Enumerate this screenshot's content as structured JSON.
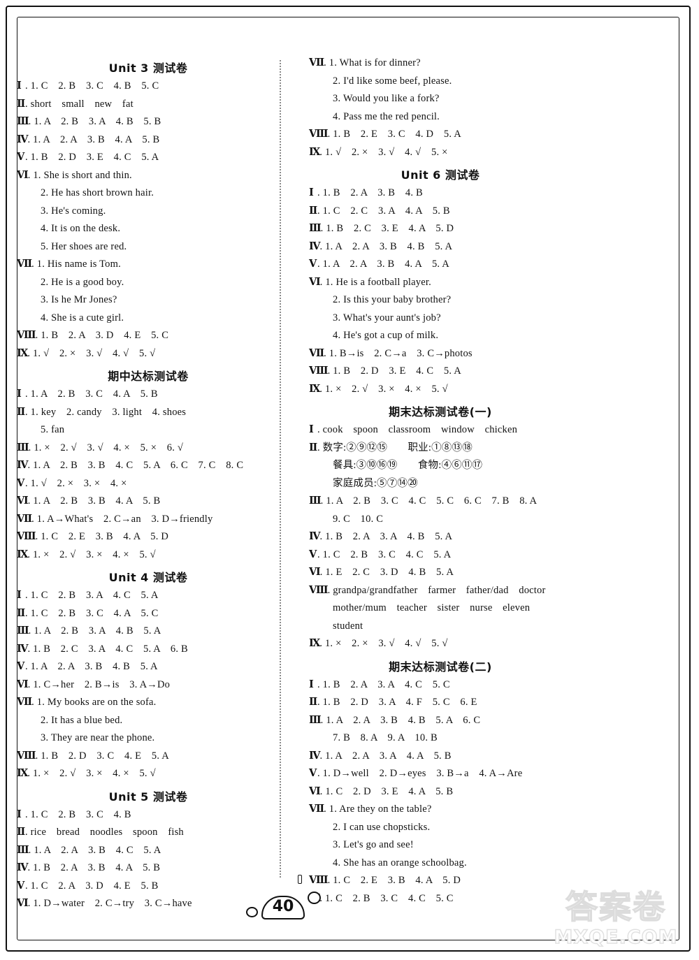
{
  "page": {
    "number": "40",
    "watermark_cn": "答案卷",
    "watermark_url": "MXQE.COM"
  },
  "left_column": {
    "sections": [
      {
        "title": "Unit 3 测试卷",
        "lines": [
          {
            "roman": "Ⅰ",
            "text": "1. C　2. B　3. C　4. B　5. C"
          },
          {
            "roman": "Ⅱ",
            "text": "short　small　new　fat"
          },
          {
            "roman": "Ⅲ",
            "text": "1. A　2. B　3. A　4. B　5. B"
          },
          {
            "roman": "Ⅳ",
            "text": "1. A　2. A　3. B　4. A　5. B"
          },
          {
            "roman": "Ⅴ",
            "text": "1. B　2. D　3. E　4. C　5. A"
          },
          {
            "roman": "Ⅵ",
            "text": "1. She is short and thin."
          },
          {
            "roman": "",
            "text": "2. He has short brown hair."
          },
          {
            "roman": "",
            "text": "3. He's coming."
          },
          {
            "roman": "",
            "text": "4. It is on the desk."
          },
          {
            "roman": "",
            "text": "5. Her shoes are red."
          },
          {
            "roman": "Ⅶ",
            "text": "1. His name is Tom."
          },
          {
            "roman": "",
            "text": "2. He is a good boy."
          },
          {
            "roman": "",
            "text": "3. Is he Mr Jones?"
          },
          {
            "roman": "",
            "text": "4. She is a cute girl."
          },
          {
            "roman": "Ⅷ",
            "text": "1. B　2. A　3. D　4. E　5. C"
          },
          {
            "roman": "Ⅸ",
            "text": "1. √　2. ×　3. √　4. √　5. √"
          }
        ]
      },
      {
        "title": "期中达标测试卷",
        "lines": [
          {
            "roman": "Ⅰ",
            "text": "1. A　2. B　3. C　4. A　5. B"
          },
          {
            "roman": "Ⅱ",
            "text": "1. key　2. candy　3. light　4. shoes"
          },
          {
            "roman": "",
            "text": "5. fan"
          },
          {
            "roman": "Ⅲ",
            "text": "1. ×　2. √　3. √　4. ×　5. ×　6. √"
          },
          {
            "roman": "Ⅳ",
            "text": "1. A　2. B　3. B　4. C　5. A　6. C　7. C　8. C"
          },
          {
            "roman": "Ⅴ",
            "text": "1. √　2. ×　3. ×　4. ×"
          },
          {
            "roman": "Ⅵ",
            "text": "1. A　2. B　3. B　4. A　5. B"
          },
          {
            "roman": "Ⅶ",
            "text": "1. A→What's　2. C→an　3. D→friendly"
          },
          {
            "roman": "Ⅷ",
            "text": "1. C　2. E　3. B　4. A　5. D"
          },
          {
            "roman": "Ⅸ",
            "text": "1. ×　2. √　3. ×　4. ×　5. √"
          }
        ]
      },
      {
        "title": "Unit 4 测试卷",
        "lines": [
          {
            "roman": "Ⅰ",
            "text": "1. C　2. B　3. A　4. C　5. A"
          },
          {
            "roman": "Ⅱ",
            "text": "1. C　2. B　3. C　4. A　5. C"
          },
          {
            "roman": "Ⅲ",
            "text": "1. A　2. B　3. A　4. B　5. A"
          },
          {
            "roman": "Ⅳ",
            "text": "1. B　2. C　3. A　4. C　5. A　6. B"
          },
          {
            "roman": "Ⅴ",
            "text": "1. A　2. A　3. B　4. B　5. A"
          },
          {
            "roman": "Ⅵ",
            "text": "1. C→her　2. B→is　3. A→Do"
          },
          {
            "roman": "Ⅶ",
            "text": "1. My books are on the sofa."
          },
          {
            "roman": "",
            "text": "2. It has a blue bed."
          },
          {
            "roman": "",
            "text": "3. They are near the phone."
          },
          {
            "roman": "Ⅷ",
            "text": "1. B　2. D　3. C　4. E　5. A"
          },
          {
            "roman": "Ⅸ",
            "text": "1. ×　2. √　3. ×　4. ×　5. √"
          }
        ]
      },
      {
        "title": "Unit 5 测试卷",
        "lines": [
          {
            "roman": "Ⅰ",
            "text": "1. C　2. B　3. C　4. B"
          },
          {
            "roman": "Ⅱ",
            "text": "rice　bread　noodles　spoon　fish"
          },
          {
            "roman": "Ⅲ",
            "text": "1. A　2. A　3. B　4. C　5. A"
          },
          {
            "roman": "Ⅳ",
            "text": "1. B　2. A　3. B　4. A　5. B"
          },
          {
            "roman": "Ⅴ",
            "text": "1. C　2. A　3. D　4. E　5. B"
          },
          {
            "roman": "Ⅵ",
            "text": "1. D→water　2. C→try　3. C→have"
          }
        ]
      }
    ]
  },
  "right_column": {
    "sections": [
      {
        "title": "",
        "lines": [
          {
            "roman": "Ⅶ",
            "text": "1. What is for dinner?"
          },
          {
            "roman": "",
            "text": "2. I'd like some beef, please."
          },
          {
            "roman": "",
            "text": "3. Would you like a fork?"
          },
          {
            "roman": "",
            "text": "4. Pass me the red pencil."
          },
          {
            "roman": "Ⅷ",
            "text": "1. B　2. E　3. C　4. D　5. A"
          },
          {
            "roman": "Ⅸ",
            "text": "1. √　2. ×　3. √　4. √　5. ×"
          }
        ]
      },
      {
        "title": "Unit 6 测试卷",
        "lines": [
          {
            "roman": "Ⅰ",
            "text": "1. B　2. A　3. B　4. B"
          },
          {
            "roman": "Ⅱ",
            "text": "1. C　2. C　3. A　4. A　5. B"
          },
          {
            "roman": "Ⅲ",
            "text": "1. B　2. C　3. E　4. A　5. D"
          },
          {
            "roman": "Ⅳ",
            "text": "1. A　2. A　3. B　4. B　5. A"
          },
          {
            "roman": "Ⅴ",
            "text": "1. A　2. A　3. B　4. A　5. A"
          },
          {
            "roman": "Ⅵ",
            "text": "1. He is a football player."
          },
          {
            "roman": "",
            "text": "2. Is this your baby brother?"
          },
          {
            "roman": "",
            "text": "3. What's your aunt's job?"
          },
          {
            "roman": "",
            "text": "4. He's got a cup of milk."
          },
          {
            "roman": "Ⅶ",
            "text": "1. B→is　2. C→a　3. C→photos"
          },
          {
            "roman": "Ⅷ",
            "text": "1. B　2. D　3. E　4. C　5. A"
          },
          {
            "roman": "Ⅸ",
            "text": "1. ×　2. √　3. ×　4. ×　5. √"
          }
        ]
      },
      {
        "title": "期末达标测试卷(一)",
        "lines": [
          {
            "roman": "Ⅰ",
            "text": "cook　spoon　classroom　window　chicken"
          },
          {
            "roman": "Ⅱ",
            "text": "数字:②⑨⑫⑮　　职业:①⑧⑬⑱"
          },
          {
            "roman": "",
            "text": "餐具:③⑩⑯⑲　　食物:④⑥⑪⑰"
          },
          {
            "roman": "",
            "text": "家庭成员:⑤⑦⑭⑳"
          },
          {
            "roman": "Ⅲ",
            "text": "1. A　2. B　3. C　4. C　5. C　6. C　7. B　8. A"
          },
          {
            "roman": "",
            "text": "9. C　10. C"
          },
          {
            "roman": "Ⅳ",
            "text": "1. B　2. A　3. A　4. B　5. A"
          },
          {
            "roman": "Ⅴ",
            "text": "1. C　2. B　3. C　4. C　5. A"
          },
          {
            "roman": "Ⅵ",
            "text": "1. E　2. C　3. D　4. B　5. A"
          },
          {
            "roman": "Ⅷ",
            "text": "grandpa/grandfather　farmer　father/dad　doctor"
          },
          {
            "roman": "",
            "text": "mother/mum　teacher　sister　nurse　eleven"
          },
          {
            "roman": "",
            "text": "student"
          },
          {
            "roman": "Ⅸ",
            "text": "1. ×　2. ×　3. √　4. √　5. √"
          }
        ]
      },
      {
        "title": "期末达标测试卷(二)",
        "lines": [
          {
            "roman": "Ⅰ",
            "text": "1. B　2. A　3. A　4. C　5. C"
          },
          {
            "roman": "Ⅱ",
            "text": "1. B　2. D　3. A　4. F　5. C　6. E"
          },
          {
            "roman": "Ⅲ",
            "text": "1. A　2. A　3. B　4. B　5. A　6. C"
          },
          {
            "roman": "",
            "text": "7. B　8. A　9. A　10. B"
          },
          {
            "roman": "Ⅳ",
            "text": "1. A　2. A　3. A　4. A　5. B"
          },
          {
            "roman": "Ⅴ",
            "text": "1. D→well　2. D→eyes　3. B→a　4. A→Are"
          },
          {
            "roman": "Ⅵ",
            "text": "1. C　2. D　3. E　4. A　5. B"
          },
          {
            "roman": "Ⅶ",
            "text": "1. Are they on the table?"
          },
          {
            "roman": "",
            "text": "2. I can use chopsticks."
          },
          {
            "roman": "",
            "text": "3. Let's go and see!"
          },
          {
            "roman": "",
            "text": "4. She has an orange schoolbag."
          },
          {
            "roman": "Ⅷ",
            "text": "1. C　2. E　3. B　4. A　5. D"
          },
          {
            "roman": "Ⅸ",
            "text": "1. C　2. B　3. C　4. C　5. C"
          }
        ]
      }
    ]
  }
}
